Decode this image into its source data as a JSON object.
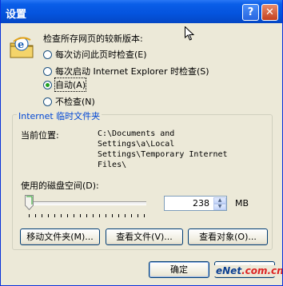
{
  "window": {
    "title": "设置"
  },
  "titlebar": {
    "help_label": "?",
    "close_label": "✕"
  },
  "check_section": {
    "heading": "检查所存网页的较新版本:",
    "options": [
      {
        "label": "每次访问此页时检查(E)",
        "selected": false
      },
      {
        "label": "每次启动 Internet Explorer 时检查(S)",
        "selected": false
      },
      {
        "label": "自动(A)",
        "selected": true
      },
      {
        "label": "不检查(N)",
        "selected": false
      }
    ]
  },
  "temp_files": {
    "group_label": "Internet 临时文件夹",
    "location_label": "当前位置:",
    "location_path": "C:\\Documents and\nSettings\\a\\Local\nSettings\\Temporary Internet\nFiles\\",
    "disk_space_label": "使用的磁盘空间(D):",
    "disk_space_value": "238",
    "disk_space_unit": "MB"
  },
  "buttons": {
    "move_folder": "移动文件夹(M)...",
    "view_files": "查看文件(V)...",
    "view_objects": "查看对象(O)...",
    "ok": "确定",
    "cancel": "取消"
  },
  "watermark": {
    "text_a": "eNet",
    "text_b": ".com.cn"
  },
  "icons": {
    "help": "help-icon",
    "close": "close-icon",
    "ie": "internet-explorer-icon"
  },
  "colors": {
    "titlebar": "#0453dd",
    "group_label": "#0046d5",
    "dialog_bg": "#ECE9D8"
  }
}
